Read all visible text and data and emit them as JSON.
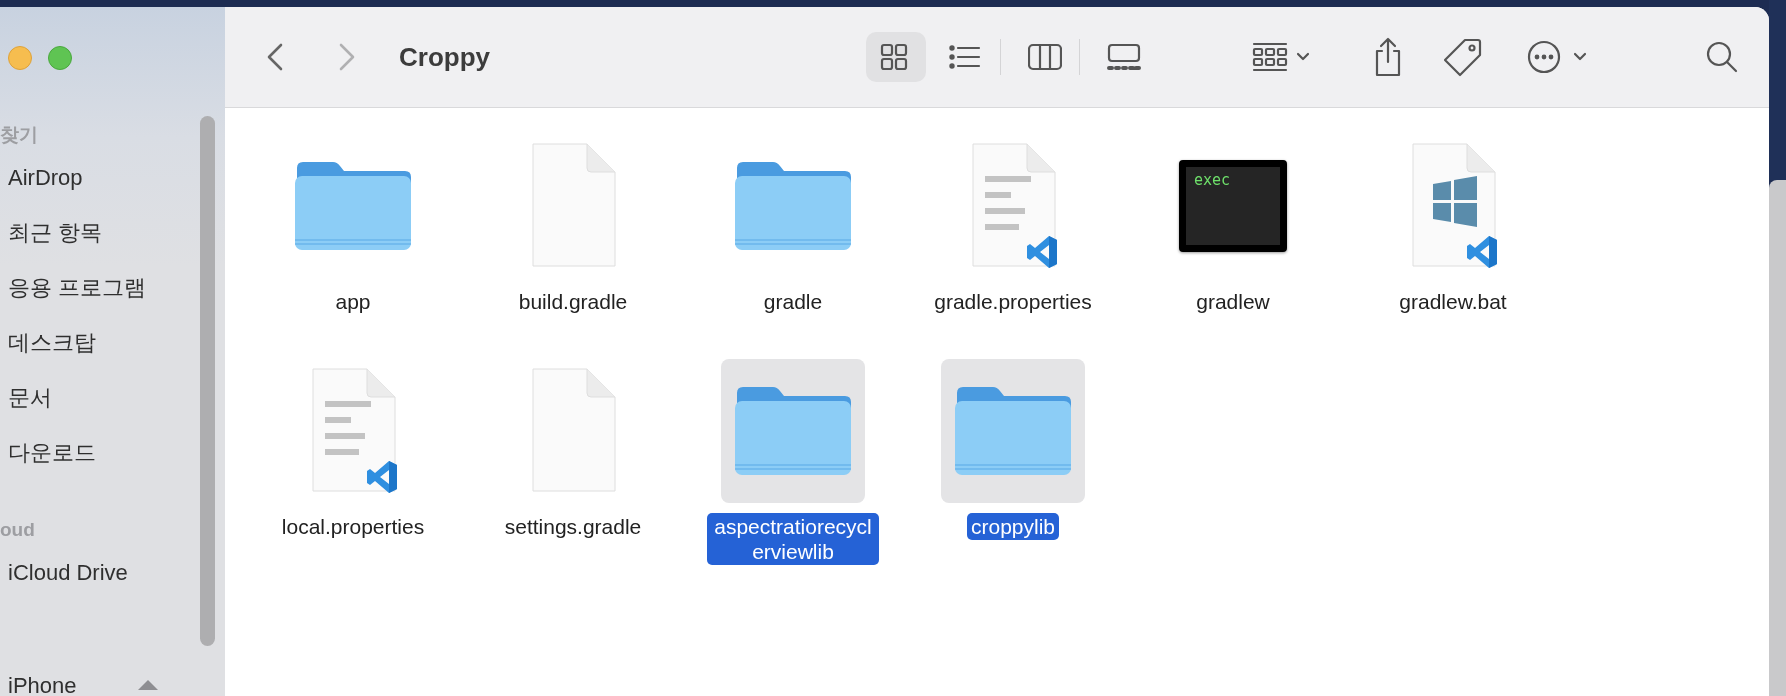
{
  "window": {
    "title": "Croppy"
  },
  "toolbar": {
    "view_modes": [
      {
        "kind": "icons",
        "selected": true
      },
      {
        "kind": "list",
        "selected": false
      },
      {
        "kind": "columns",
        "selected": false
      },
      {
        "kind": "gallery",
        "selected": false
      }
    ]
  },
  "sidebar": {
    "sections": [
      {
        "heading": "찾기",
        "items": [
          {
            "label": "AirDrop"
          },
          {
            "label": "최근 항목"
          },
          {
            "label": "응용 프로그램"
          },
          {
            "label": "데스크탑"
          },
          {
            "label": "문서"
          },
          {
            "label": "다운로드"
          }
        ]
      },
      {
        "heading": "oud",
        "items": [
          {
            "label": "iCloud Drive"
          }
        ]
      },
      {
        "items": [
          {
            "label": "iPhone",
            "eject": true
          }
        ]
      }
    ]
  },
  "files": [
    {
      "name": "app",
      "kind": "folder",
      "selected": false
    },
    {
      "name": "build.gradle",
      "kind": "blank",
      "selected": false
    },
    {
      "name": "gradle",
      "kind": "folder",
      "selected": false
    },
    {
      "name": "gradle.properties",
      "kind": "code",
      "selected": false
    },
    {
      "name": "gradlew",
      "kind": "exec",
      "icon_text": "exec",
      "selected": false
    },
    {
      "name": "gradlew.bat",
      "kind": "windows",
      "selected": false
    },
    {
      "name": "local.properties",
      "kind": "code",
      "selected": false
    },
    {
      "name": "settings.gradle",
      "kind": "blank",
      "selected": false
    },
    {
      "name": "aspectratiorecyclerviewlib",
      "kind": "folder",
      "selected": true
    },
    {
      "name": "croppylib",
      "kind": "folder",
      "selected": true
    }
  ]
}
